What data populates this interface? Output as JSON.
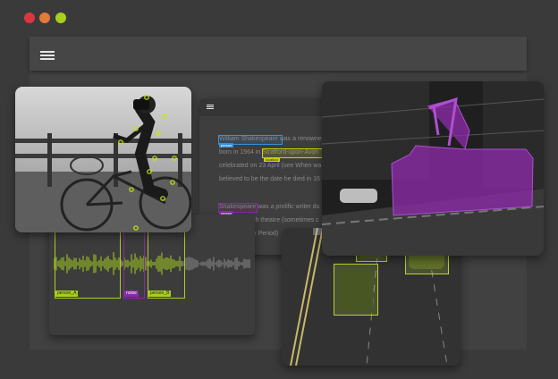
{
  "window": {
    "controls": [
      {
        "name": "close",
        "color": "#d9363e"
      },
      {
        "name": "minimize",
        "color": "#e07b39"
      },
      {
        "name": "maximize",
        "color": "#a8cf1f"
      }
    ],
    "menu_icon": "hamburger-menu-icon"
  },
  "text_panel": {
    "menu_icon": "hamburger-menu-icon",
    "lines": [
      "William Shakespeare was a renowned",
      "born in 1564 in Stratford-upon-Avon",
      "celebrated on 23 April (see When wa",
      "believed to be the date he died in 16",
      "Shakespeare was a prolific writer du",
      "ages of British theatre (sometimes c",
      "Early Modern Period)"
    ],
    "entity_tags": [
      {
        "label": "person",
        "color": "#3a8fd6"
      },
      {
        "label": "location",
        "color": "#c8d400"
      },
      {
        "label": "person",
        "color": "#8a2aa8"
      }
    ]
  },
  "audio_panel": {
    "segments": [
      {
        "label": "person_A",
        "color": "#a8cf1f"
      },
      {
        "label": "noise",
        "color": "#8a2aa8"
      },
      {
        "label": "person_B",
        "color": "#a8cf1f"
      }
    ]
  },
  "images": {
    "cyclist": {
      "keypoint_color": "#c8e600"
    },
    "tram": {
      "segmentation_color": "#8a2aa8"
    },
    "cars": {
      "box_color": "#b7d632"
    }
  }
}
